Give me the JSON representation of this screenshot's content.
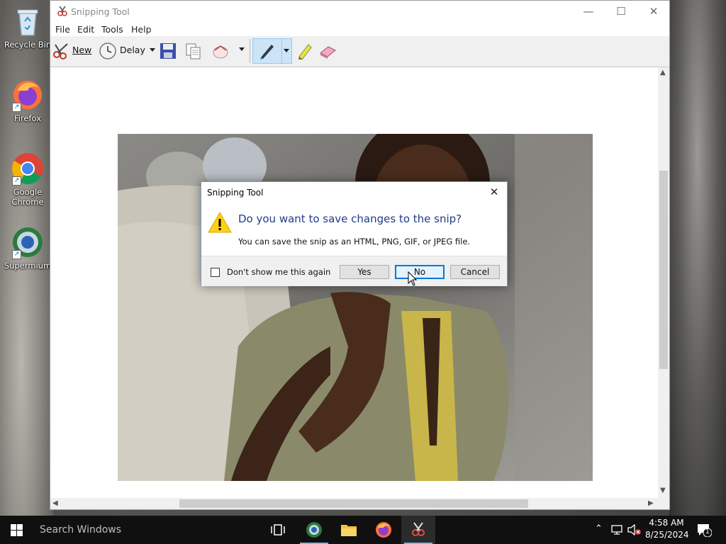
{
  "desktop": {
    "icons": [
      {
        "label": "Recycle Bin"
      },
      {
        "label": "Firefox"
      },
      {
        "label": "Google Chrome"
      },
      {
        "label": "Supermium"
      }
    ]
  },
  "window": {
    "title": "Snipping Tool",
    "menu": [
      "File",
      "Edit",
      "Tools",
      "Help"
    ],
    "toolbar": {
      "new_label": "New",
      "delay_label": "Delay"
    }
  },
  "dialog": {
    "title": "Snipping Tool",
    "heading": "Do you want to save changes to the snip?",
    "message": "You can save the snip as an HTML, PNG, GIF, or JPEG file.",
    "checkbox_label": "Don't show me this again",
    "checkbox_checked": false,
    "buttons": {
      "yes": "Yes",
      "no": "No",
      "cancel": "Cancel"
    }
  },
  "taskbar": {
    "search_placeholder": "Search Windows",
    "time": "4:58 AM",
    "date": "8/25/2024",
    "notification_count": "1"
  },
  "colors": {
    "dialog_heading": "#1f3c88",
    "focus_border": "#0078d7",
    "taskbar_bg": "#101010",
    "active_indicator": "#76b9ed"
  }
}
